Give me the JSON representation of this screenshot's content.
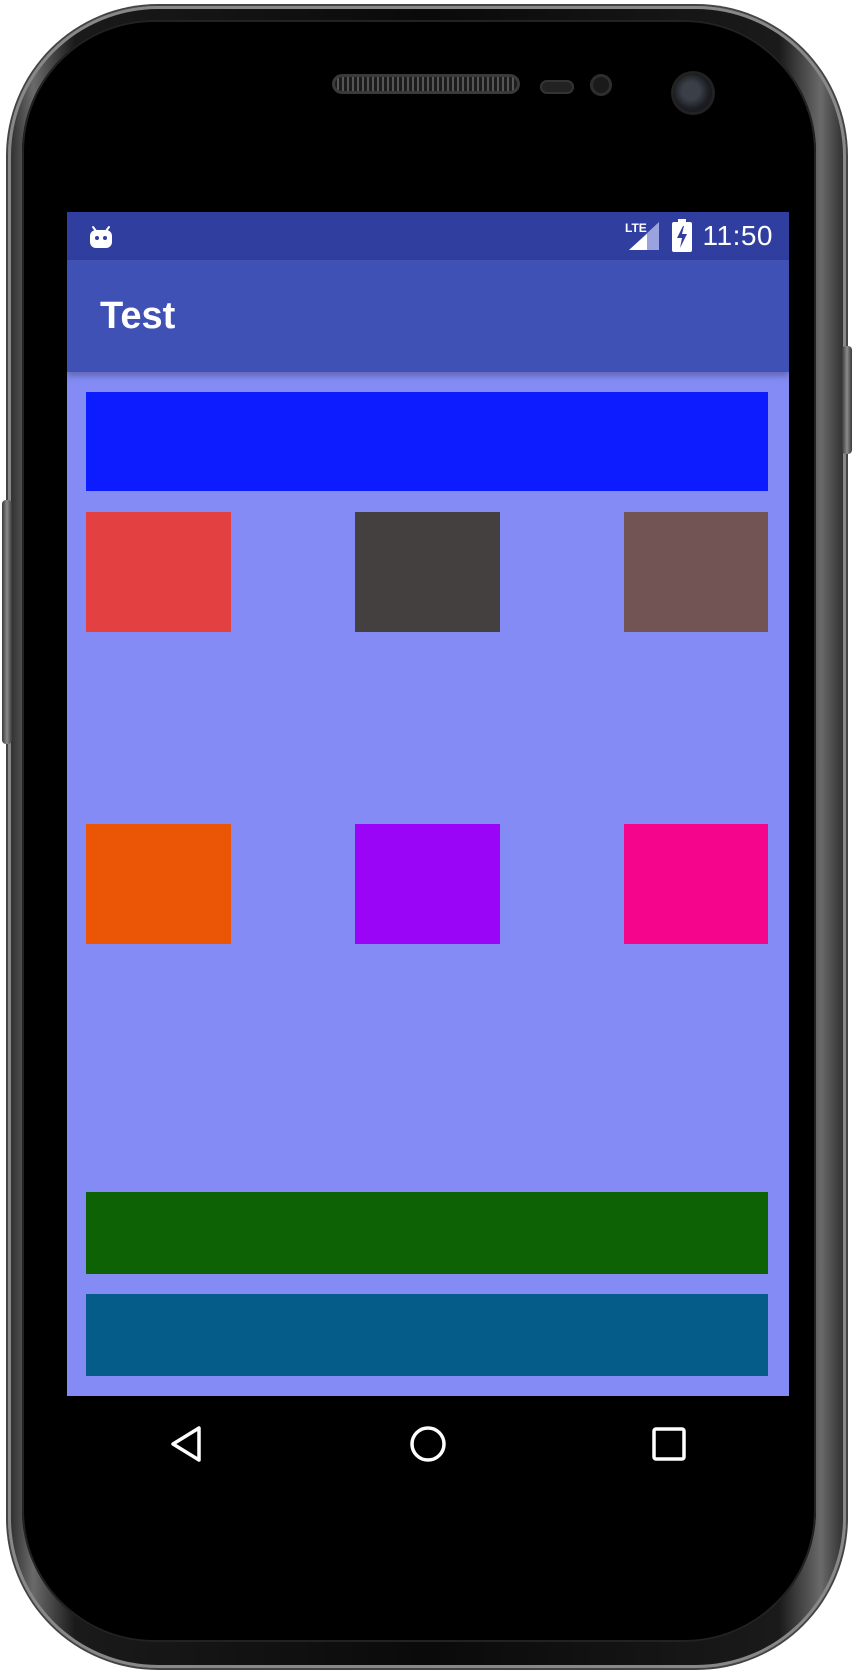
{
  "app": {
    "title": "Test"
  },
  "status_bar": {
    "notification_icon": "android-icon",
    "network_label": "LTE",
    "battery_icon": "battery-charging-icon",
    "time": "11:50"
  },
  "colors": {
    "status_bar": "#303f9f",
    "app_bar": "#3f51b5",
    "content_background": "#848bf4"
  },
  "blocks": [
    {
      "name": "top-bar",
      "color": "#0d1cff"
    },
    {
      "name": "square-red",
      "color": "#e34042"
    },
    {
      "name": "square-dark-gray",
      "color": "#444040"
    },
    {
      "name": "square-brown",
      "color": "#725455"
    },
    {
      "name": "square-orange",
      "color": "#ea5506"
    },
    {
      "name": "square-purple",
      "color": "#9b05f7"
    },
    {
      "name": "square-pink",
      "color": "#f5058b"
    },
    {
      "name": "bottom-bar-green",
      "color": "#0e6206"
    },
    {
      "name": "bottom-bar-teal",
      "color": "#055c88"
    }
  ],
  "nav_bar": {
    "buttons": [
      "back-icon",
      "home-icon",
      "recents-icon"
    ]
  }
}
